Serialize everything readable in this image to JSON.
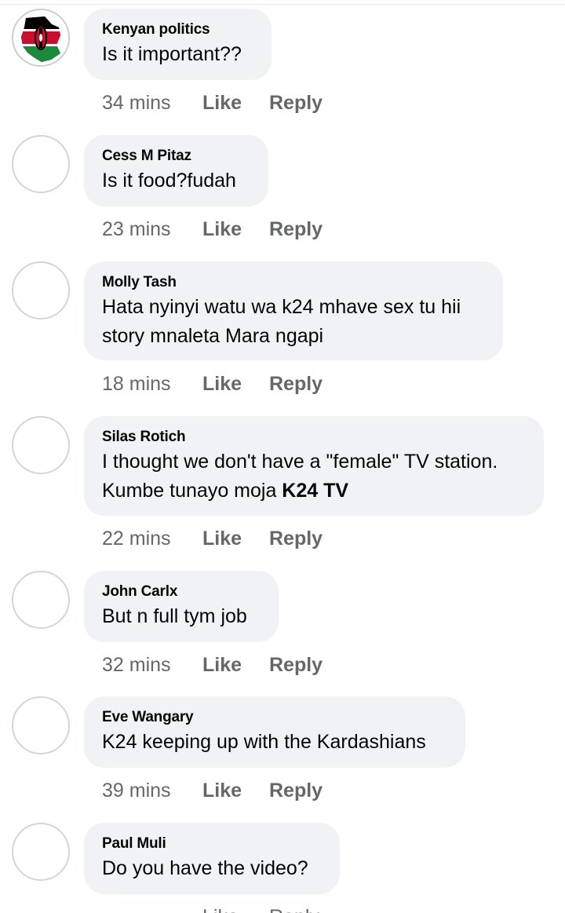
{
  "comments": [
    {
      "author": "Kenyan politics",
      "text": "Is it important??",
      "time": "34 mins",
      "like": "Like",
      "reply": "Reply",
      "avatar": "kenya-flag-map-icon"
    },
    {
      "author": "Cess M Pitaz",
      "text": "Is it food?fudah",
      "time": "23 mins",
      "like": "Like",
      "reply": "Reply"
    },
    {
      "author": "Molly Tash",
      "text_lines": [
        "Hata nyinyi watu wa k24 mhave sex tu hii",
        "story mnaleta Mara ngapi"
      ],
      "time": "18 mins",
      "like": "Like",
      "reply": "Reply"
    },
    {
      "author": "Silas Rotich",
      "text_lines": [
        "I thought we don't have a \"female\" TV station.",
        "Kumbe tunayo moja "
      ],
      "text_bold": "K24 TV",
      "time": "22 mins",
      "like": "Like",
      "reply": "Reply"
    },
    {
      "author": "John Carlx",
      "text": "But n full tym job",
      "time": "32 mins",
      "like": "Like",
      "reply": "Reply"
    },
    {
      "author": "Eve Wangary",
      "text": "K24 keeping up with the Kardashians",
      "time": "39 mins",
      "like": "Like",
      "reply": "Reply"
    },
    {
      "author": "Paul Muli",
      "text": "Do you have the video?",
      "time": "",
      "like": "Like",
      "reply": "Reply"
    }
  ],
  "colors": {
    "bubble": "#f0f2f5",
    "meta": "#65676b",
    "text": "#050505"
  }
}
